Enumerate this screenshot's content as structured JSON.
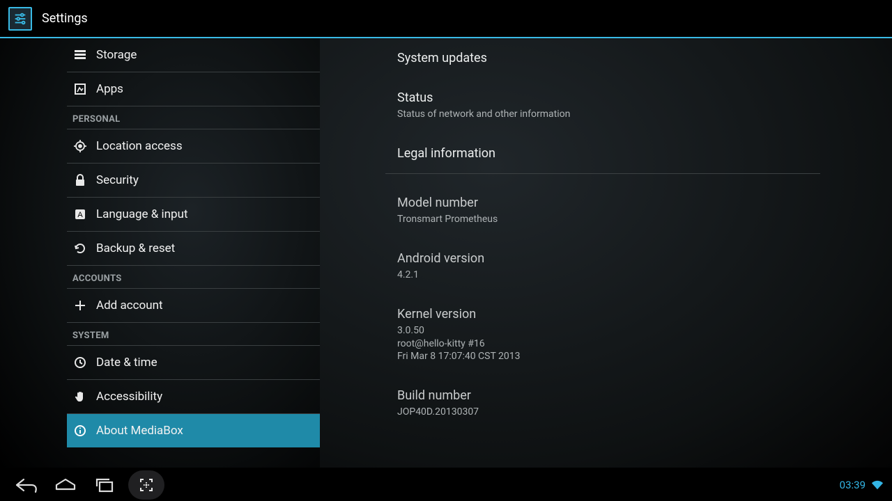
{
  "header": {
    "title": "Settings"
  },
  "sidebar": {
    "items": [
      {
        "label": "Storage",
        "icon": "storage-icon"
      },
      {
        "label": "Apps",
        "icon": "apps-icon"
      },
      {
        "header": "PERSONAL"
      },
      {
        "label": "Location access",
        "icon": "location-icon"
      },
      {
        "label": "Security",
        "icon": "lock-icon"
      },
      {
        "label": "Language & input",
        "icon": "language-icon"
      },
      {
        "label": "Backup & reset",
        "icon": "backup-icon"
      },
      {
        "header": "ACCOUNTS"
      },
      {
        "label": "Add account",
        "icon": "plus-icon"
      },
      {
        "header": "SYSTEM"
      },
      {
        "label": "Date & time",
        "icon": "clock-icon"
      },
      {
        "label": "Accessibility",
        "icon": "hand-icon"
      },
      {
        "label": "About MediaBox",
        "icon": "info-icon",
        "selected": true
      }
    ]
  },
  "detail": {
    "items": [
      {
        "title": "System updates"
      },
      {
        "title": "Status",
        "subtitle": "Status of network and other information"
      },
      {
        "title": "Legal information"
      },
      {
        "gap": true
      },
      {
        "title": "Model number",
        "subtitle": "Tronsmart Prometheus",
        "readonly": true
      },
      {
        "title": "Android version",
        "subtitle": "4.2.1",
        "readonly": true
      },
      {
        "title": "Kernel version",
        "subtitle": "3.0.50\nroot@hello-kitty #16\nFri Mar 8 17:07:40 CST 2013",
        "readonly": true
      },
      {
        "title": "Build number",
        "subtitle": "JOP40D.20130307",
        "readonly": true
      }
    ]
  },
  "status_bar": {
    "time": "03:39"
  }
}
